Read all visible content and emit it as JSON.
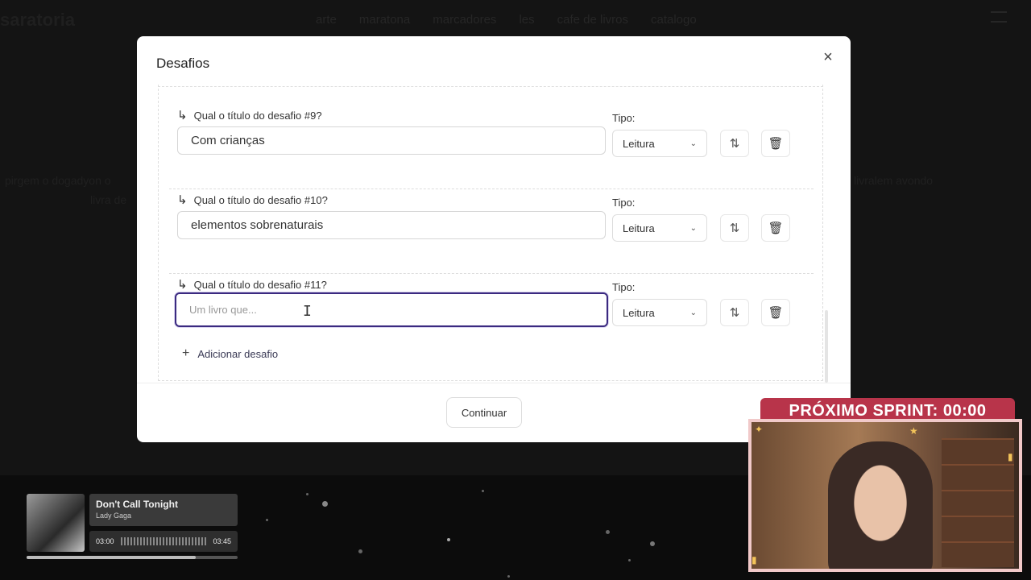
{
  "background": {
    "logo": "saratoria",
    "nav": [
      "arte",
      "maratona",
      "marcadores",
      "les",
      "cafe de livros",
      "catalogo"
    ],
    "text_left": "pirgem o dogadyon o",
    "text_left_2": "livra de",
    "text_right": "livralem avondo",
    "text_right_2": ""
  },
  "modal": {
    "title": "Desafios",
    "close_icon": "×",
    "challenges": [
      {
        "label": "Qual o título do desafio #9?",
        "value": "Com crianças",
        "placeholder": "",
        "tipo_label": "Tipo:",
        "tipo_value": "Leitura"
      },
      {
        "label": "Qual o título do desafio #10?",
        "value": "elementos sobrenaturais",
        "placeholder": "",
        "tipo_label": "Tipo:",
        "tipo_value": "Leitura"
      },
      {
        "label": "Qual o título do desafio #11?",
        "value": "",
        "placeholder": "Um livro que...",
        "tipo_label": "Tipo:",
        "tipo_value": "Leitura"
      }
    ],
    "add_label": "Adicionar desafio",
    "continue_label": "Continuar"
  },
  "player": {
    "title": "Don't Call Tonight",
    "artist": "Lady Gaga",
    "elapsed": "03:00",
    "total": "03:45",
    "progress": 0.8
  },
  "stream": {
    "sprint_text": "PRÓXIMO SPRINT: 00:00"
  },
  "colors": {
    "accent": "#3b2a80",
    "sprint_badge": "#b8344a"
  },
  "icons": {
    "arrow": "arrow-return-icon",
    "sort": "sort-arrows-icon",
    "trash": "trash-icon",
    "plus": "plus-icon",
    "chevron": "chevron-down-icon",
    "close": "close-icon"
  }
}
